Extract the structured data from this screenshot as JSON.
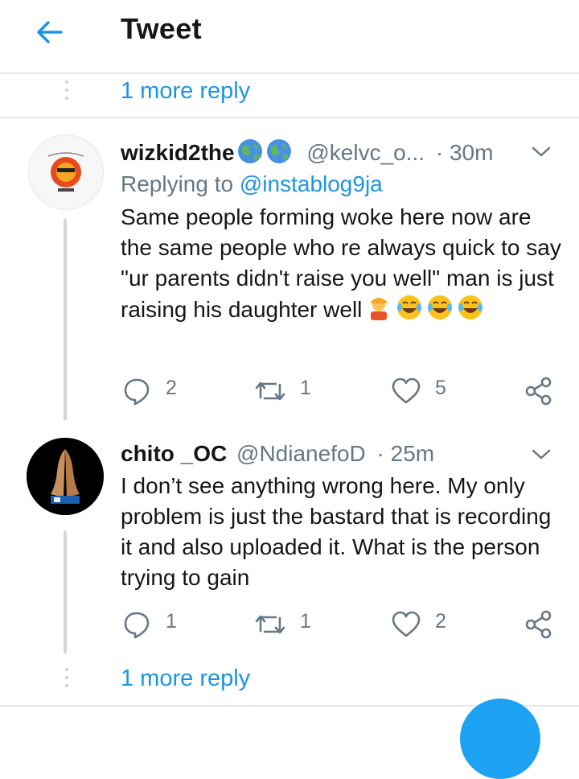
{
  "header": {
    "title": "Tweet",
    "back_icon": "arrow-left-icon"
  },
  "thread_top": {
    "more_reply_label": "1 more reply"
  },
  "replies": [
    {
      "display_name": "wizkid2the",
      "handle": "@kelvc_o...",
      "time": "· 30m",
      "replying_prefix": "Replying to",
      "replying_handle": "@instablog9ja",
      "text": "Same people forming woke here now are the same people who re always quick to say \"ur parents didn't raise you well\" man is just raising his daughter well",
      "emojis": [
        "person-with-hat-emoji",
        "tears-of-joy-emoji",
        "tears-of-joy-emoji",
        "tears-of-joy-emoji"
      ],
      "reply_count": "2",
      "retweet_count": "1",
      "like_count": "5"
    },
    {
      "display_name": "chito _OC",
      "handle": "@NdianefoD",
      "time": "· 25m",
      "text": "I don’t see anything wrong here. My only problem is just the bastard that is recording it and also uploaded it. What is the person trying to gain",
      "reply_count": "1",
      "retweet_count": "1",
      "like_count": "2"
    }
  ],
  "thread_bottom": {
    "more_reply_label": "1 more reply"
  },
  "colors": {
    "accent": "#1b95e0",
    "muted": "#657786",
    "text": "#14171a",
    "divider": "#e1e8ed",
    "fab": "#1da1f2"
  }
}
